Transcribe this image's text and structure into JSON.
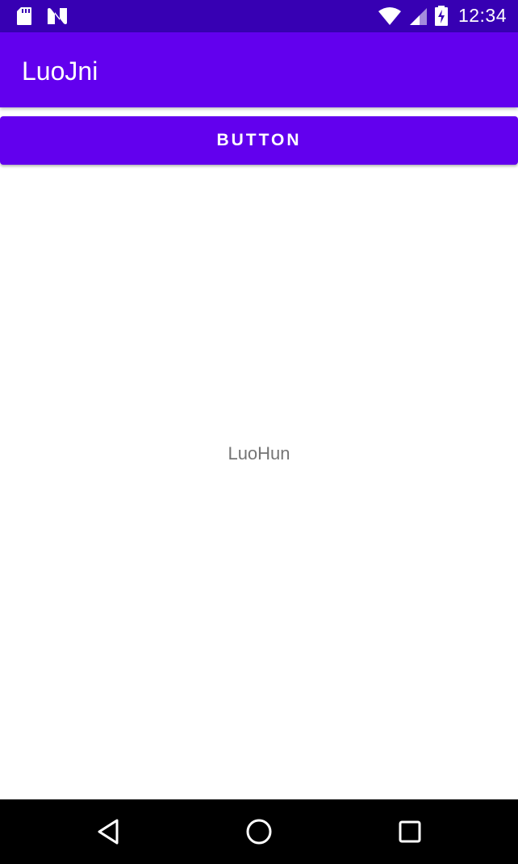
{
  "status_bar": {
    "time": "12:34",
    "left_icons": [
      "sd-card-icon",
      "notification-n-icon"
    ],
    "right_icons": [
      "wifi-icon",
      "signal-icon",
      "battery-charging-icon"
    ],
    "background": "#3700b3"
  },
  "app_bar": {
    "title": "LuoJni",
    "background": "#6200ee"
  },
  "main": {
    "button_label": "BUTTON",
    "center_text": "LuoHun"
  },
  "nav_bar": {
    "icons": [
      "back-icon",
      "home-icon",
      "recents-icon"
    ]
  },
  "colors": {
    "primary": "#6200ee",
    "primary_dark": "#3700b3",
    "text_secondary": "#757575"
  }
}
